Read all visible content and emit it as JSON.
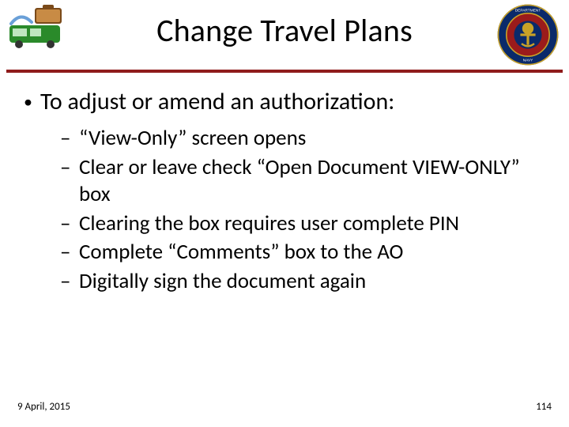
{
  "header": {
    "title": "Change Travel Plans",
    "accent_color": "#8f1b1b"
  },
  "icons": {
    "travel_name": "travel-clipart-icon",
    "seal_name": "navy-department-seal-icon"
  },
  "content": {
    "lead": "To adjust or amend an authorization:",
    "sub_items": [
      "“View-Only” screen opens",
      "Clear or leave check “Open Document VIEW-ONLY” box",
      "Clearing the box requires user complete PIN",
      "Complete “Comments” box to the AO",
      "Digitally sign the document again"
    ]
  },
  "footer": {
    "date": "9 April, 2015",
    "page": "114"
  }
}
